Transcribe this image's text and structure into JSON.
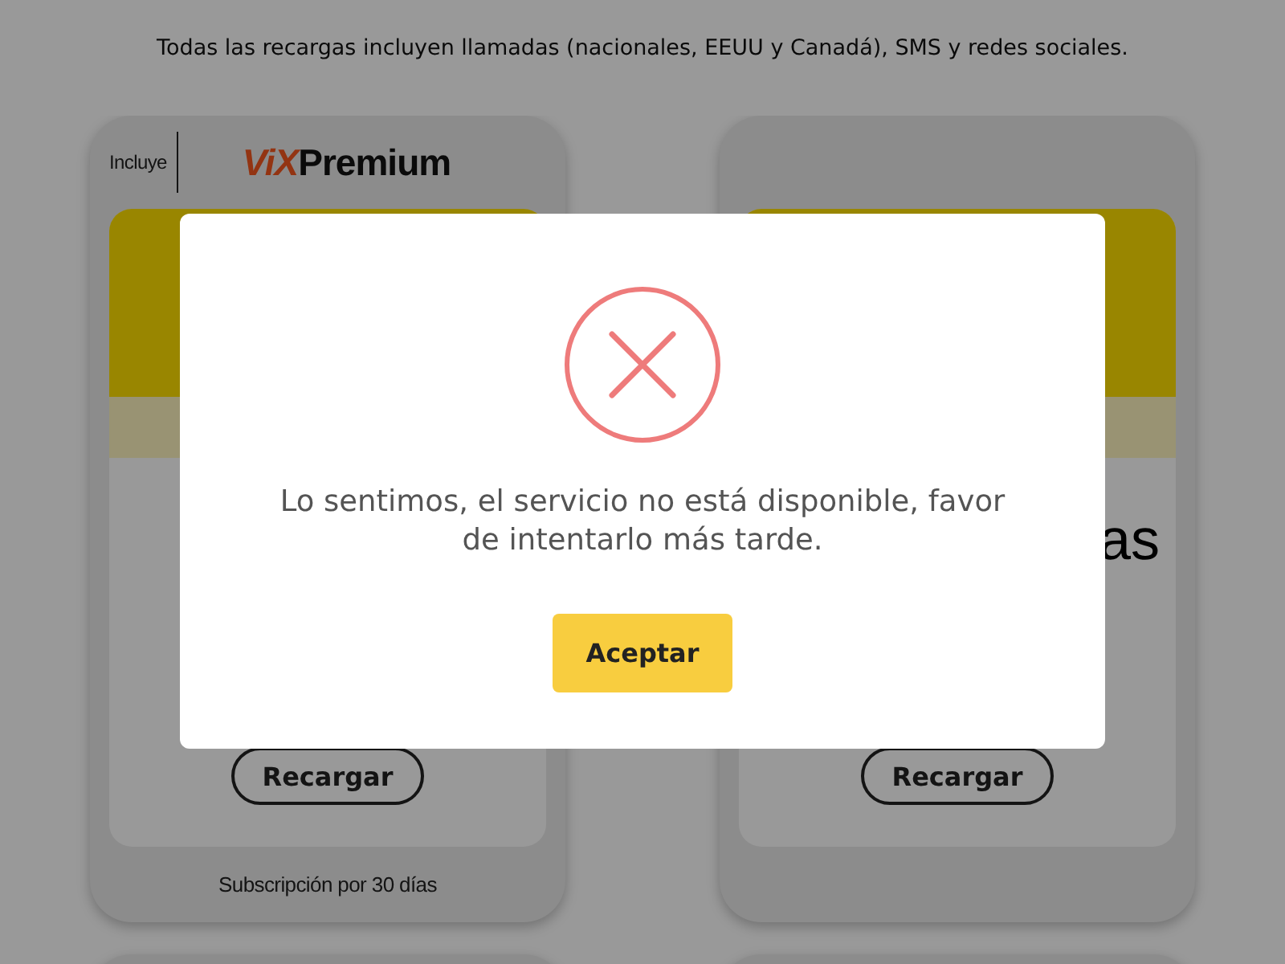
{
  "notice": "Todas las recargas incluyen llamadas (nacionales, EEUU y Canadá), SMS y redes sociales.",
  "cards": [
    {
      "kind": "plan",
      "includes_label": "Incluye",
      "logo": {
        "brand": "ViX",
        "tier": "Premium"
      },
      "button": "Recargar",
      "footer": "Subscripción por 30 días"
    },
    {
      "kind": "plan",
      "fragment": "as",
      "button": "Recargar"
    },
    {
      "kind": "plan"
    },
    {
      "kind": "plan"
    }
  ],
  "dialog": {
    "open": true,
    "kind": "error",
    "message": "Lo sentimos, el servicio no está disponible, favor de intentarlo más tarde.",
    "button": "Aceptar"
  }
}
